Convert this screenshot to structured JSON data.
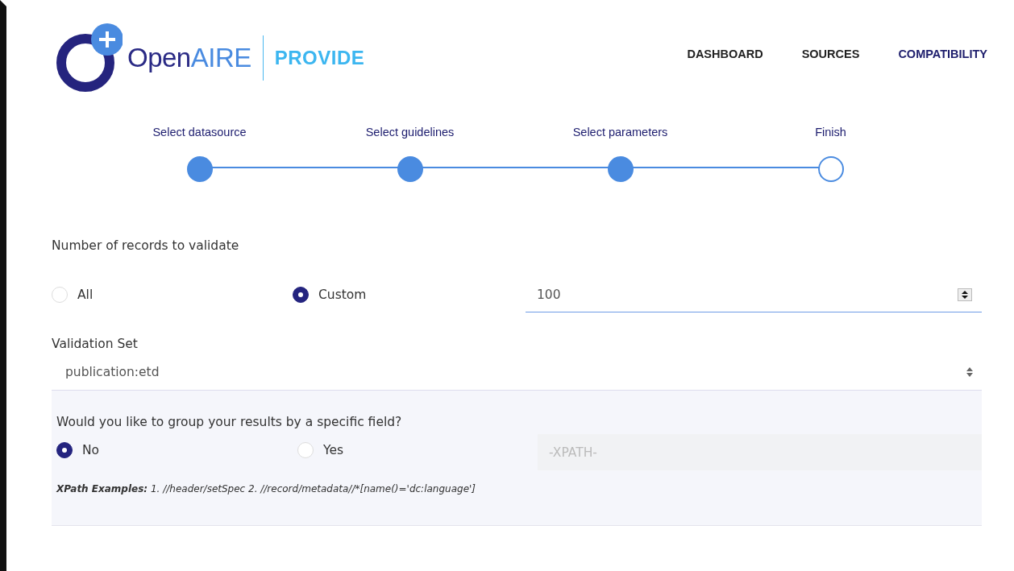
{
  "logo": {
    "word_1": "Open",
    "word_2": "AIRE",
    "product": "PROVIDE"
  },
  "nav": [
    {
      "label": "DASHBOARD",
      "selected": false
    },
    {
      "label": "SOURCES",
      "selected": false
    },
    {
      "label": "COMPATIBILITY",
      "selected": true
    }
  ],
  "steps": [
    {
      "label": "Select datasource",
      "done": true
    },
    {
      "label": "Select guidelines",
      "done": true
    },
    {
      "label": "Select parameters",
      "done": true
    },
    {
      "label": "Finish",
      "done": false
    }
  ],
  "records": {
    "label": "Number of records to validate",
    "options": [
      {
        "label": "All",
        "selected": false
      },
      {
        "label": "Custom",
        "selected": true
      }
    ],
    "value": "100"
  },
  "validation_set": {
    "label": "Validation Set",
    "value": "publication:etd"
  },
  "grouping": {
    "question": "Would you like to group your results by a specific field?",
    "options": [
      {
        "label": "No",
        "selected": true
      },
      {
        "label": "Yes",
        "selected": false
      }
    ],
    "placeholder": "-XPATH-",
    "examples": "**XPath Examples:** 1. //header/setSpec 2. //record/metadata//*[name()='dc:language']"
  }
}
